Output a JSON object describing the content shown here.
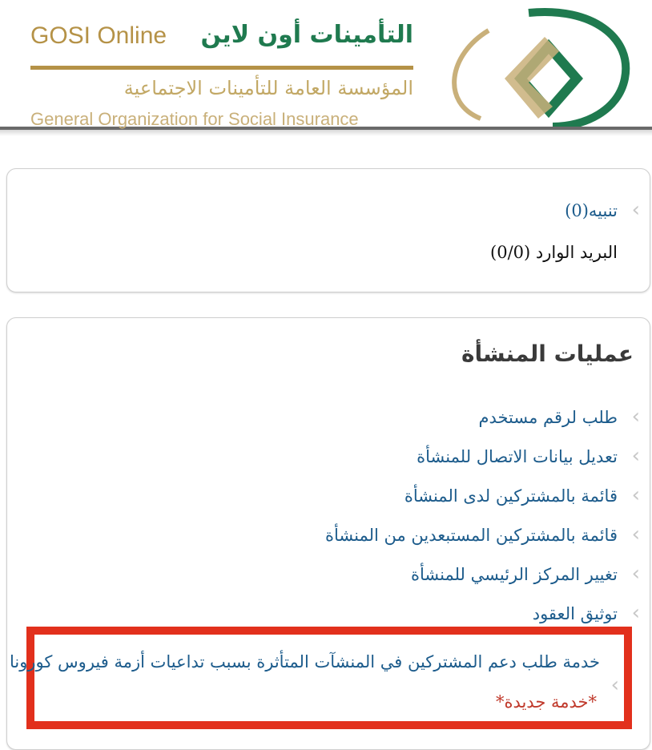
{
  "header": {
    "arabic_brand": "التأمينات أون لاين",
    "english_brand": "GOSI Online",
    "arabic_org": "المؤسسة العامة للتأمينات الاجتماعية",
    "english_org": "General Organization for Social Insurance",
    "logo_icon": "gosi-logo-icon",
    "colors": {
      "green": "#1f7a4f",
      "gold": "#b59247"
    }
  },
  "notifications": {
    "alert_label": "تنبيه(0)",
    "inbox_label": "البريد الوارد (0/0)"
  },
  "establishment": {
    "title": "عمليات المنشأة",
    "links": [
      "طلب لرقم مستخدم",
      "تعديل بيانات الاتصال للمنشأة",
      "قائمة بالمشتركين لدى المنشأة",
      "قائمة بالمشتركين المستبعدين من المنشأة",
      "تغيير المركز الرئيسي للمنشأة",
      "توثيق العقود"
    ],
    "highlight_link": "خدمة طلب دعم المشتركين في المنشآت المتأثرة بسبب تداعيات أزمة فيروس كورونا",
    "highlight_badge": "*خدمة جديدة*",
    "highlight_color": "#e2301c"
  }
}
